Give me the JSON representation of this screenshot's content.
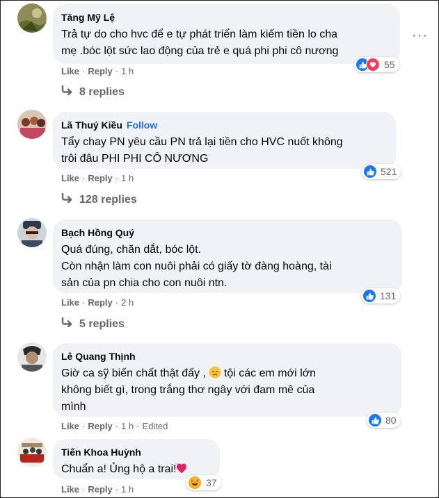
{
  "colors": {
    "accent": "#216fdb",
    "bubble": "#f0f2f5",
    "meta": "#65676b",
    "like": "#1877f2",
    "love": "#f33e58",
    "haha": "#f7b125"
  },
  "actions": {
    "like": "Like",
    "reply": "Reply",
    "dot": "·",
    "more": "···"
  },
  "comments": [
    {
      "author": "Tăng Mỹ Lệ",
      "text": "Trả tự do cho hvc để e tự phát triển làm kiếm tiền lo cha\nmẹ .bóc lột sức lao động của trẻ e quá phi phi cô nương",
      "time": "1 h",
      "reactions": [
        "like-icon",
        "love-icon"
      ],
      "reaction_count": "55",
      "replies": "8 replies"
    },
    {
      "author": "Lã Thuý Kiều",
      "follow": "Follow",
      "text": "Tẩy chay PN yêu cầu PN trả lại tiền cho HVC nuốt không\ntrôi đâu PHI PHI CÔ NƯƠNG",
      "time": "1 h",
      "reactions": [
        "like-icon"
      ],
      "reaction_count": "521",
      "replies": "128 replies"
    },
    {
      "author": "Bạch Hồng Quý",
      "text": "Quá đúng, chăn dắt, bóc lột.\nCòn nhận làm con nuôi phải có giấy tờ đàng hoàng, tài\nsản của pn chia cho con nuôi ntn.",
      "time": "2 h",
      "reactions": [
        "like-icon"
      ],
      "reaction_count": "131",
      "replies": "5 replies"
    },
    {
      "author": "Lê Quang Thịnh",
      "text_before_emoji": "Giờ ca sỹ biến chất thật đấy ,",
      "emoji": "sad-face-emoji",
      "text_after_emoji": "tội các em mới lớn\nkhông biết gì, trong trắng thơ ngây với đam mê của\nmình",
      "time": "1 h",
      "edited": "Edited",
      "reactions": [
        "like-icon"
      ],
      "reaction_count": "80"
    },
    {
      "author": "Tiến Khoa Huỳnh",
      "text": "Chuẩn a! Ủng hộ a trai!",
      "emoji": "red-heart-emoji",
      "time": "1 h",
      "reactions": [
        "haha-icon"
      ],
      "reaction_count": "37"
    }
  ]
}
